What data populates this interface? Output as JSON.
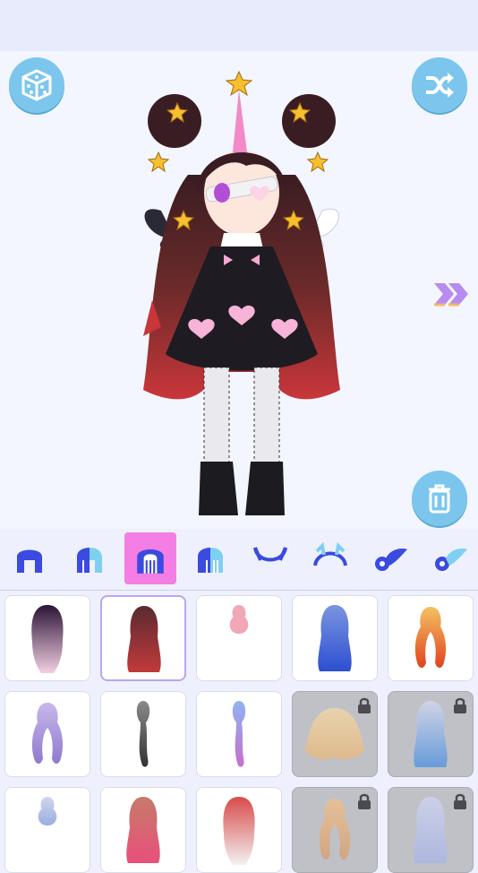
{
  "app": {
    "colors": {
      "accent_blue": "#7cc6ee",
      "tab_icon": "#3b4ae0",
      "tab_selected_bg": "#f47ee3",
      "arrow": "#b78cf0",
      "locked_bg": "#bfc1c7"
    }
  },
  "toolbar": {
    "random_icon": "dice-icon",
    "shuffle_icon": "shuffle-icon",
    "delete_icon": "trash-icon",
    "next_icon": "double-chevron-right-icon"
  },
  "tabs": [
    {
      "icon": "hair-front-icon",
      "selected": false
    },
    {
      "icon": "hair-front-color-icon",
      "selected": false
    },
    {
      "icon": "hair-back-icon",
      "selected": true
    },
    {
      "icon": "hair-back-color-icon",
      "selected": false
    },
    {
      "icon": "horns-icon",
      "selected": false
    },
    {
      "icon": "horns-color-icon",
      "selected": false
    },
    {
      "icon": "wings-icon",
      "selected": false
    },
    {
      "icon": "wings-color-icon",
      "selected": false
    }
  ],
  "items": [
    {
      "style": "split",
      "colors": [
        "#2a1436",
        "#f3cfe2"
      ],
      "selected": false,
      "locked": false
    },
    {
      "style": "long",
      "colors": [
        "#5a2a32",
        "#c23a3a"
      ],
      "selected": true,
      "locked": false
    },
    {
      "style": "bun",
      "colors": [
        "#f1a7b5",
        "#f1a7b5"
      ],
      "selected": false,
      "locked": false
    },
    {
      "style": "long",
      "colors": [
        "#7a95e0",
        "#2d4fd1"
      ],
      "selected": false,
      "locked": false
    },
    {
      "style": "twin",
      "colors": [
        "#f4c163",
        "#e0431f"
      ],
      "selected": false,
      "locked": false
    },
    {
      "style": "twin",
      "colors": [
        "#c7b8ea",
        "#8f7ad0"
      ],
      "selected": false,
      "locked": false
    },
    {
      "style": "pony",
      "colors": [
        "#8a8a8a",
        "#333333"
      ],
      "selected": false,
      "locked": false
    },
    {
      "style": "pony",
      "colors": [
        "#8fb4f0",
        "#c66fd0"
      ],
      "selected": false,
      "locked": false
    },
    {
      "style": "wavy",
      "colors": [
        "#f6d8a4",
        "#e9b77a"
      ],
      "selected": false,
      "locked": true
    },
    {
      "style": "long",
      "colors": [
        "#d6d9ee",
        "#4a8fe0"
      ],
      "selected": false,
      "locked": true
    },
    {
      "style": "bun",
      "colors": [
        "#cfd6ee",
        "#9aaee0"
      ],
      "selected": false,
      "locked": false
    },
    {
      "style": "long",
      "colors": [
        "#c77a6a",
        "#e8507a"
      ],
      "selected": false,
      "locked": false
    },
    {
      "style": "split",
      "colors": [
        "#d94a4a",
        "#f2f2f2"
      ],
      "selected": false,
      "locked": false
    },
    {
      "style": "twin",
      "colors": [
        "#f0c08c",
        "#d99c6a"
      ],
      "selected": false,
      "locked": true
    },
    {
      "style": "long",
      "colors": [
        "#d0d6f2",
        "#a9b4e6"
      ],
      "selected": false,
      "locked": true
    }
  ]
}
